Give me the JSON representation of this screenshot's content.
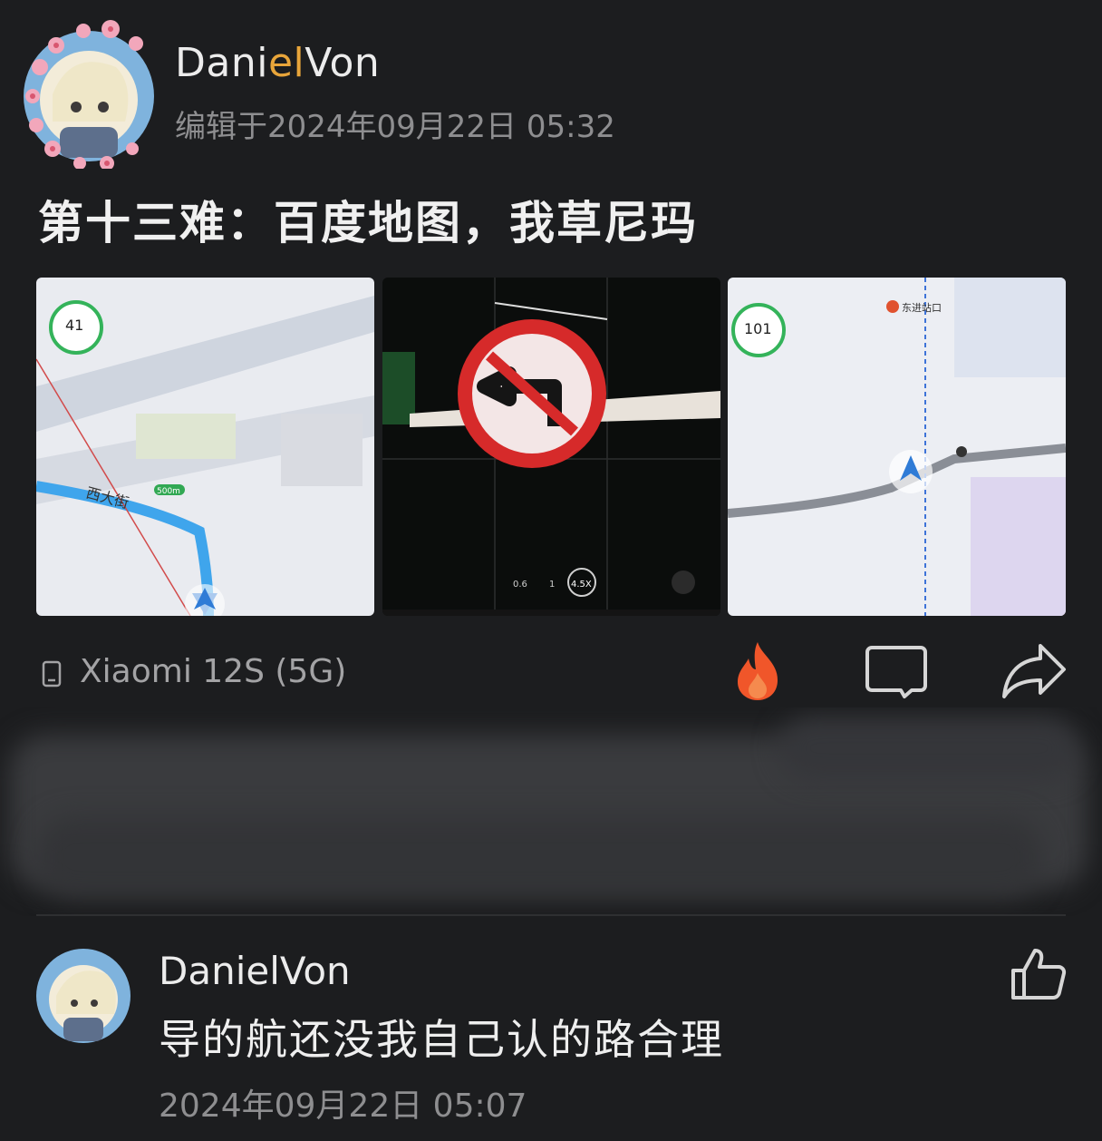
{
  "post": {
    "author_name_pre": "Dani",
    "author_name_hl": "el",
    "author_name_post": "Von",
    "edit_time": "编辑于2024年09月22日 05:32",
    "title": "第十三难：百度地图，我草尼玛",
    "images": [
      {
        "icon": "map-screenshot",
        "speed_badge": "41",
        "street_label": "西大街",
        "distance_badge": "500m"
      },
      {
        "icon": "no-left-turn-sign-photo",
        "zoom_labels": [
          "0.6",
          "1",
          "4.5X"
        ]
      },
      {
        "icon": "map-screenshot",
        "speed_badge": "101",
        "poi_label": "东进站口"
      }
    ],
    "device": "Xiaomi 12S (5G)",
    "actions": {
      "hot": "fire-icon",
      "comment": "comment-icon",
      "share": "share-icon"
    }
  },
  "comment": {
    "author": "DanielVon",
    "text": "导的航还没我自己认的路合理",
    "time": "2024年09月22日 05:07",
    "like": "thumbs-up-icon"
  },
  "colors": {
    "background": "#1c1d1f",
    "accent_name": "#e8a53a",
    "fire": "#f0562a",
    "muted_text": "#8e8e90"
  }
}
